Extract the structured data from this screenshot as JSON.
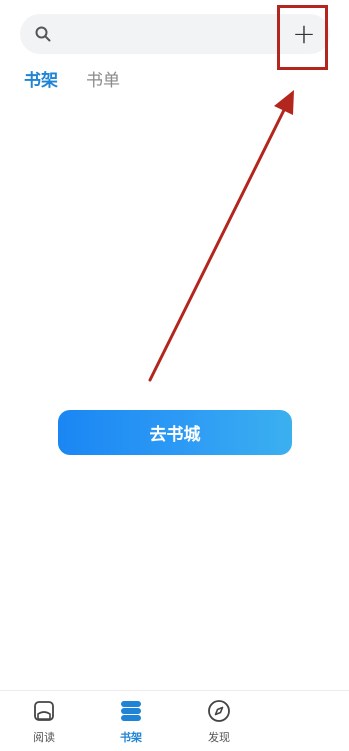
{
  "search": {
    "placeholder": ""
  },
  "header": {
    "add_label": "+"
  },
  "tabs": [
    {
      "label": "书架",
      "active": true
    },
    {
      "label": "书单",
      "active": false
    }
  ],
  "main": {
    "cta_label": "去书城"
  },
  "bottom_nav": [
    {
      "label": "阅读",
      "icon": "book-reader-icon",
      "active": false
    },
    {
      "label": "书架",
      "icon": "bookshelf-icon",
      "active": true
    },
    {
      "label": "发现",
      "icon": "compass-icon",
      "active": false
    }
  ],
  "annotation": {
    "color": "#b3261e"
  },
  "colors": {
    "accent": "#1f84d6"
  }
}
